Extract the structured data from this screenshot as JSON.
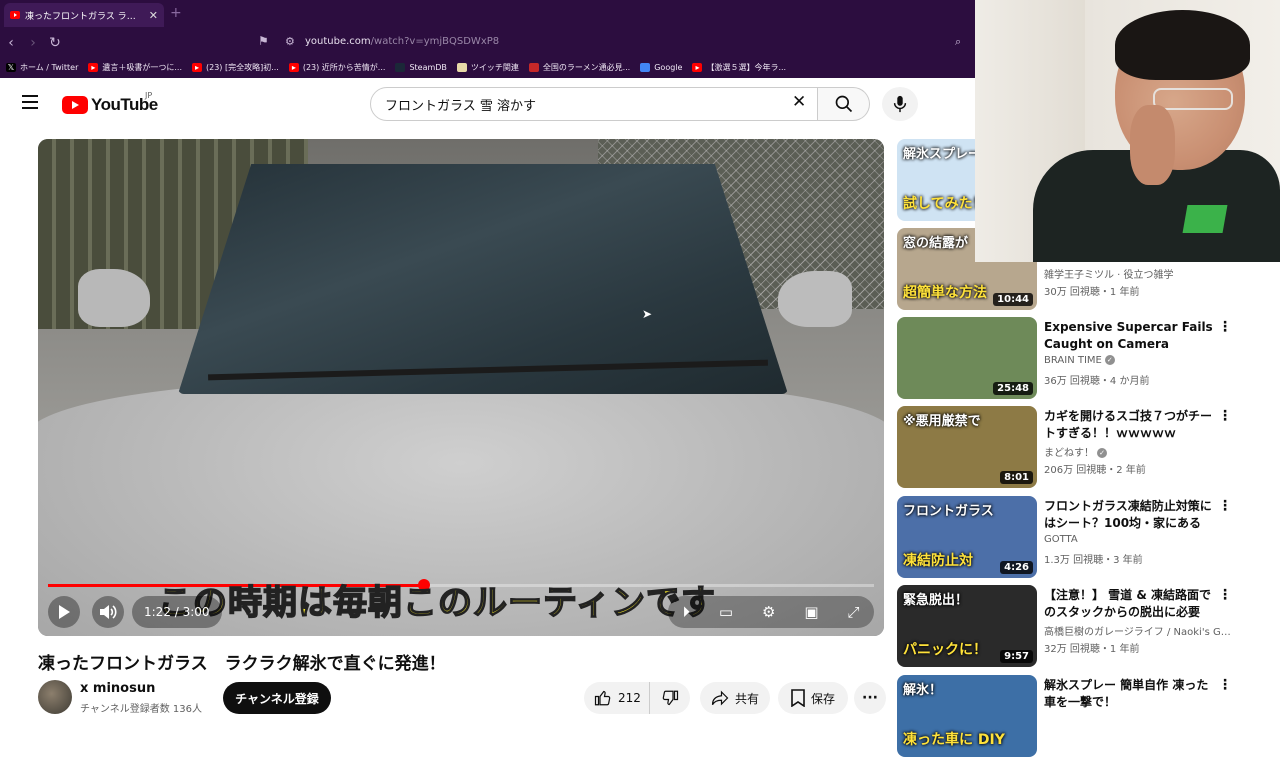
{
  "browser": {
    "tab_title": "凍ったフロントガラス ラクラク解氷で",
    "new_tab": "+",
    "url_host": "youtube.com",
    "url_path": "/watch?v=ymjBQSDWxP8",
    "bookmarks": [
      {
        "label": "ホーム / Twitter",
        "icon": "x-icon",
        "color": "#000000"
      },
      {
        "label": "遺言＋吸書が一つに...",
        "icon": "youtube-icon",
        "color": "#ff0000"
      },
      {
        "label": "(23) [完全攻略]初...",
        "icon": "youtube-icon",
        "color": "#ff0000"
      },
      {
        "label": "(23) 近所から苦情が...",
        "icon": "youtube-icon",
        "color": "#ff0000"
      },
      {
        "label": "SteamDB",
        "icon": "steamdb-icon",
        "color": "#1b2838"
      },
      {
        "label": "ツイッチ関連",
        "icon": "folder-icon",
        "color": "#e8d9a8"
      },
      {
        "label": "全国のラーメン通必見...",
        "icon": "ramen-icon",
        "color": "#c62828"
      },
      {
        "label": "Google",
        "icon": "google-icon",
        "color": "#4285f4"
      },
      {
        "label": "【激選５選】今年ラ...",
        "icon": "youtube-icon",
        "color": "#ff0000"
      }
    ]
  },
  "youtube": {
    "logo_text": "YouTube",
    "logo_region": "JP",
    "search_value": "フロントガラス 雪 溶かす"
  },
  "player": {
    "subtitle": "この時期は毎朝このルーティンです",
    "time": "1:22 / 3:00",
    "progress": 0.4556
  },
  "video": {
    "title": "凍ったフロントガラス　ラクラク解氷で直ぐに発進！",
    "channel": "x minosun",
    "subscribers": "チャンネル登録者数 136人",
    "subscribe_label": "チャンネル登録",
    "likes": "212",
    "share_label": "共有",
    "save_label": "保存"
  },
  "sidebar": [
    {
      "thumb_text": "解氷スプレー",
      "thumb_text2": "試してみた！",
      "duration": "",
      "title": "",
      "channel": "",
      "meta": "",
      "bg": "#cfe3f3"
    },
    {
      "thumb_text": "窓の結露が",
      "thumb_text2": "超簡単な方法",
      "duration": "10:44",
      "title": "",
      "channel": "雑学王子ミツル · 役立つ雑学",
      "meta": "30万 回視聴・1 年前",
      "bg": "#b7a78e"
    },
    {
      "thumb_text": "",
      "thumb_text2": "",
      "duration": "25:48",
      "title": "Expensive Supercar Fails Caught on Camera",
      "channel": "BRAIN TIME",
      "meta": "36万 回視聴・4 か月前",
      "bg": "#6e8a59",
      "verified": true
    },
    {
      "thumb_text": "※悪用厳禁で",
      "thumb_text2": "",
      "duration": "8:01",
      "title": "カギを開けるスゴ技７つがチートすぎる！！ｗｗｗｗｗ",
      "channel": "まどねす！",
      "meta": "206万 回視聴・2 年前",
      "bg": "#8d7a45",
      "verified": true
    },
    {
      "thumb_text": "フロントガラス",
      "thumb_text2": "凍結防止対",
      "duration": "4:26",
      "title": "フロントガラス凍結防止対策にはシート？100均・家にあるも...",
      "channel": "GOTTA",
      "meta": "1.3万 回視聴・3 年前",
      "bg": "#4c6fa8"
    },
    {
      "thumb_text": "緊急脱出！",
      "thumb_text2": "パニックに！",
      "duration": "9:57",
      "title": "【注意！】 雪道 & 凍結路面でのスタックからの脱出に必要な...",
      "channel": "高橋巨樹のガレージライフ / Naoki's Gar...",
      "meta": "32万 回視聴・1 年前",
      "bg": "#2a2a2a"
    },
    {
      "thumb_text": "解氷！",
      "thumb_text2": "凍った車に DIY",
      "duration": "",
      "title": "解氷スプレー 簡単自作 凍った車を一撃で！",
      "channel": "",
      "meta": "",
      "bg": "#3d6fa6"
    }
  ]
}
